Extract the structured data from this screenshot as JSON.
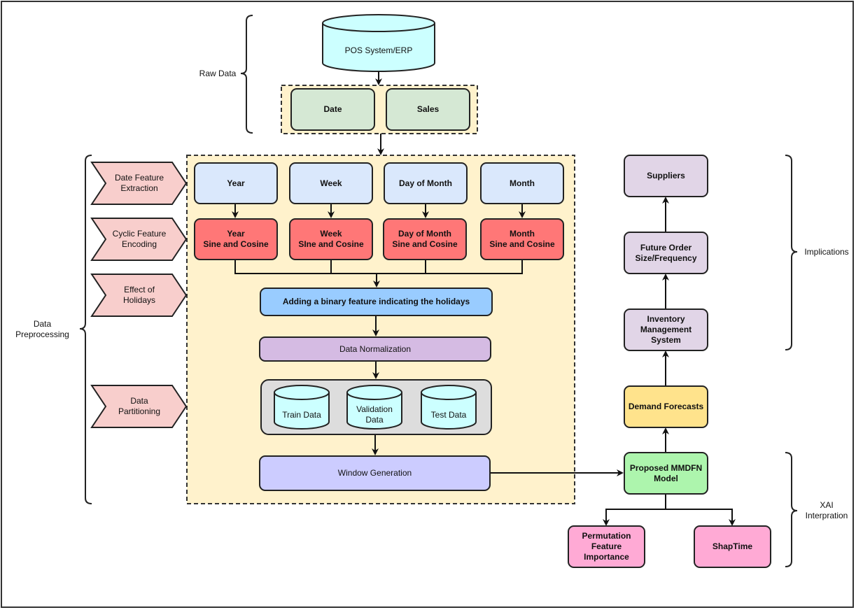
{
  "diagram": {
    "colors": {
      "cylinder": "#ccffff",
      "green_light": "#d5e8d4",
      "blue_light": "#dae8fc",
      "red": "#ff7777",
      "blue_mid": "#99ccff",
      "purple_light": "#d5bbe3",
      "gray": "#dddddd",
      "lavender": "#ccccff",
      "mauve": "#e1d5e7",
      "yellow": "#ffe38c",
      "green": "#adf5ad",
      "pink": "#ffaad5",
      "chevron": "#f8cecc",
      "panel": "#fff2cc"
    },
    "groups": {
      "raw_data": "Raw Data",
      "data_preprocessing": "Data\nPreprocessing",
      "implications": "Implications",
      "xai": "XAI\nInterpration"
    },
    "source": "POS System/ERP",
    "raw_fields": [
      "Date",
      "Sales"
    ],
    "steps": {
      "date_feature_extraction": "Date Feature\nExtraction",
      "cyclic_feature_encoding": "Cyclic Feature\nEncoding",
      "effect_of_holidays": "Effect of\nHolidays",
      "data_partitioning": "Data\nPartitioning"
    },
    "date_features": [
      "Year",
      "Week",
      "Day of Month",
      "Month"
    ],
    "cyclic_features": [
      "Year\nSine and Cosine",
      "Week\nSIne and Cosine",
      "Day of Month\nSine and Cosine",
      "Month\nSine and Cosine"
    ],
    "holiday_feature": "Adding a binary feature indicating the holidays",
    "normalization": "Data Normalization",
    "splits": [
      "Train Data",
      "Validation\nData",
      "Test Data"
    ],
    "window_generation": "Window Generation",
    "model": "Proposed MMDFN\nModel",
    "forecasts": "Demand Forecasts",
    "inventory": "Inventory\nManagement\nSystem",
    "future_order": "Future Order\nSize/Frequency",
    "suppliers": "Suppliers",
    "xai_methods": [
      "Permutation\nFeature\nImportance",
      "ShapTime"
    ]
  }
}
